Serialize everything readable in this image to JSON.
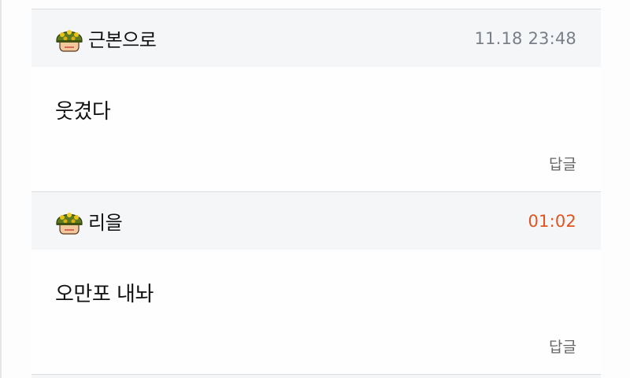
{
  "comments": [
    {
      "author": "근본으로",
      "timestamp": "11.18 23:48",
      "text": "웃겼다",
      "reply_label": "답글",
      "timestamp_color": "#7a7f87"
    },
    {
      "author": "리을",
      "timestamp": "01:02",
      "text": "오만포 내놔",
      "reply_label": "답글",
      "timestamp_color": "#e0541f"
    }
  ],
  "colors": {
    "header_background": "#f5f6f8",
    "divider": "#dcdcdc",
    "recent_timestamp": "#e0541f"
  },
  "icons": {
    "avatar": "soldier-helmet-avatar-icon"
  }
}
